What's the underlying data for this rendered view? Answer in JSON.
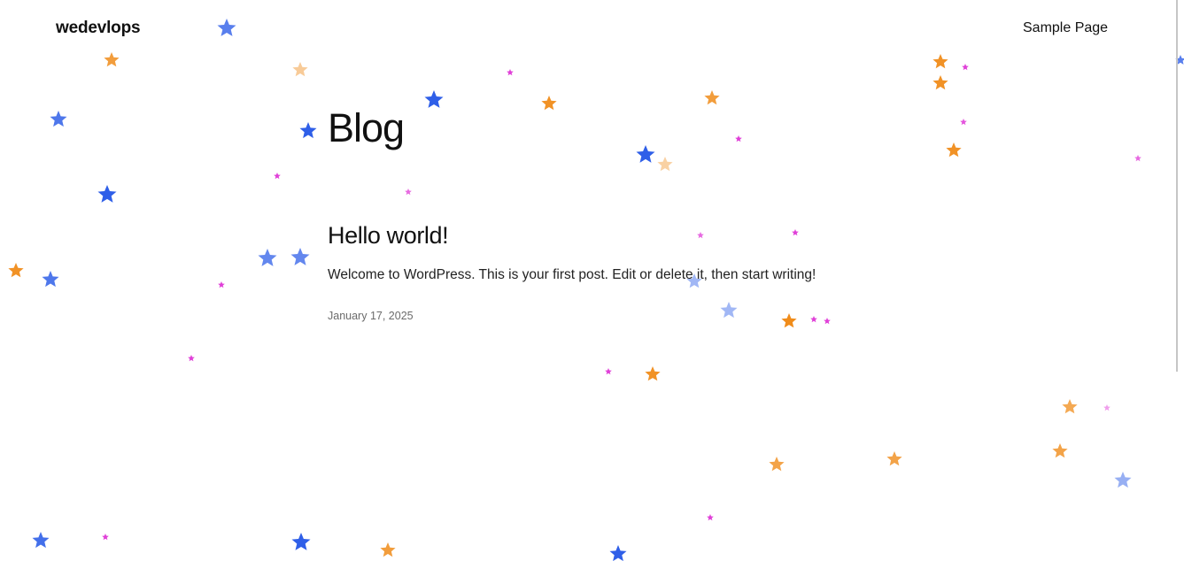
{
  "header": {
    "site_title": "wedevlops",
    "nav": [
      {
        "label": "Sample Page"
      }
    ]
  },
  "main": {
    "page_heading": "Blog",
    "posts": [
      {
        "title": "Hello world!",
        "excerpt": "Welcome to WordPress. This is your first post. Edit or delete it, then start writing!",
        "date": "January 17, 2025"
      }
    ]
  },
  "decoration": {
    "star_colors": {
      "blue": "#2f5fe8",
      "orange": "#f08c1a",
      "magenta": "#dd2bd4"
    }
  }
}
